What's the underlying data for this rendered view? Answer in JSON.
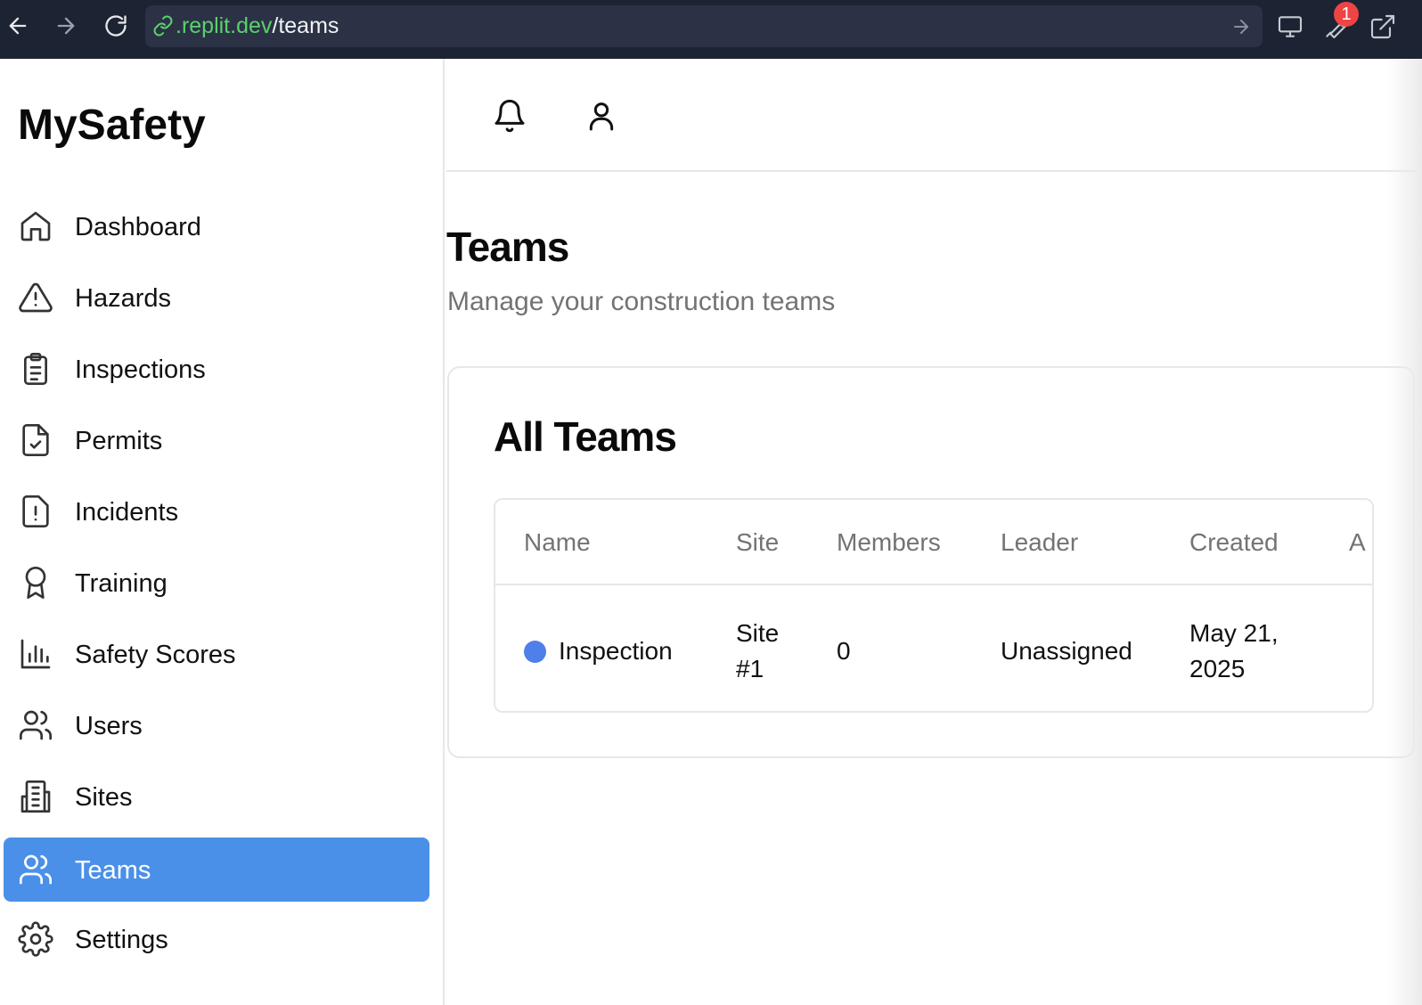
{
  "browser": {
    "url_domain": ".replit.dev",
    "url_path": "/teams",
    "badge_count": "1",
    "icons": [
      "back-arrow-icon",
      "forward-arrow-icon",
      "reload-icon",
      "link-icon",
      "go-arrow-icon",
      "monitor-icon",
      "wrench-icon",
      "external-link-icon"
    ]
  },
  "sidebar": {
    "brand": "MySafety",
    "items": [
      {
        "label": "Dashboard",
        "icon": "home-icon"
      },
      {
        "label": "Hazards",
        "icon": "warning-triangle-icon"
      },
      {
        "label": "Inspections",
        "icon": "clipboard-icon"
      },
      {
        "label": "Permits",
        "icon": "file-check-icon"
      },
      {
        "label": "Incidents",
        "icon": "file-alert-icon"
      },
      {
        "label": "Training",
        "icon": "award-icon"
      },
      {
        "label": "Safety Scores",
        "icon": "bar-chart-icon"
      },
      {
        "label": "Users",
        "icon": "users-icon"
      },
      {
        "label": "Sites",
        "icon": "building-icon"
      },
      {
        "label": "Teams",
        "icon": "users-icon",
        "active": true
      },
      {
        "label": "Settings",
        "icon": "gear-icon"
      }
    ],
    "active_color": "#4a90e8"
  },
  "header": {
    "icons": [
      "bell-icon",
      "user-icon"
    ]
  },
  "main": {
    "title": "Teams",
    "subtitle": "Manage your construction teams",
    "card": {
      "title": "All Teams",
      "columns": [
        "Name",
        "Site",
        "Members",
        "Leader",
        "Created",
        "A"
      ],
      "rows": [
        {
          "name": "Inspection",
          "site_line1": "Site",
          "site_line2": "#1",
          "members": "0",
          "leader": "Unassigned",
          "created_line1": "May 21,",
          "created_line2": "2025",
          "dot_color": "#4f7fe8"
        }
      ]
    }
  }
}
